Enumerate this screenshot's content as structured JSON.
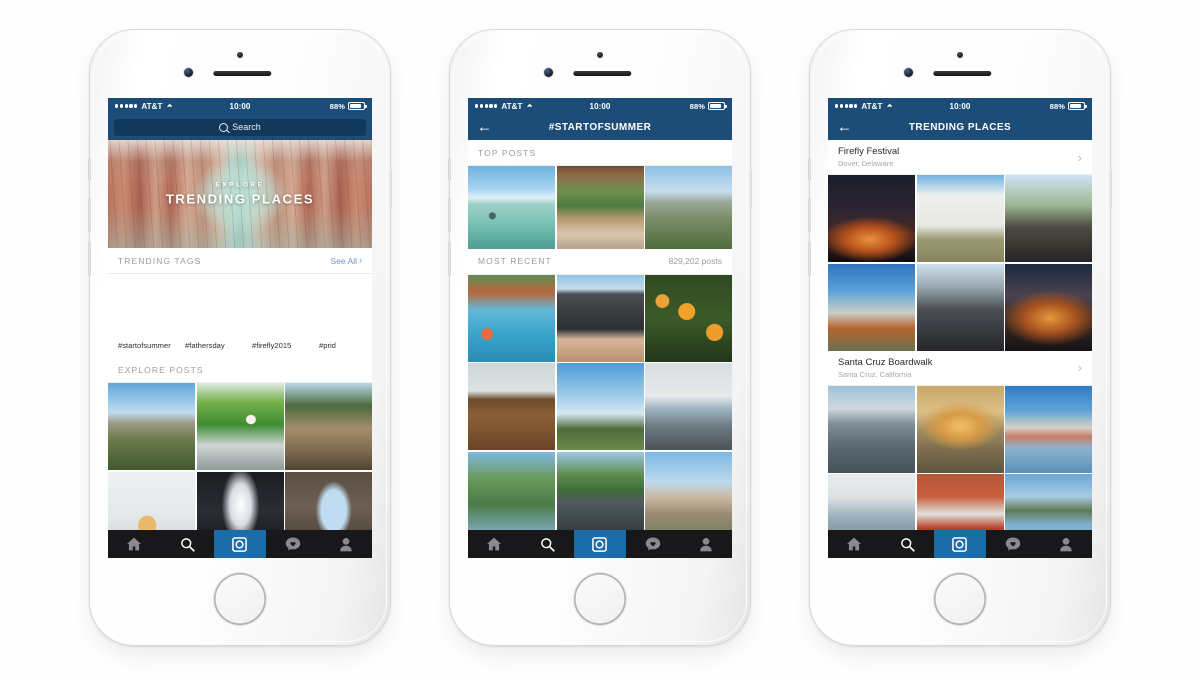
{
  "status_bar": {
    "carrier": "AT&T",
    "time": "10:00",
    "battery_percent": "88%",
    "signal_dots": 5
  },
  "phone1": {
    "search": {
      "placeholder": "Search",
      "value": "Search"
    },
    "hero": {
      "eyebrow": "EXPLORE",
      "title": "TRENDING PLACES"
    },
    "trending_tags": {
      "section_label": "TRENDING TAGS",
      "see_all": "See All",
      "items": [
        {
          "label": "#startofsummer",
          "art": "p-surf"
        },
        {
          "label": "#fathersday",
          "art": "p-dogman"
        },
        {
          "label": "#firefly2015",
          "art": "p-firefly"
        },
        {
          "label": "#prid",
          "art": "p-pride"
        }
      ]
    },
    "explore_posts": {
      "section_label": "EXPLORE POSTS",
      "tiles": [
        "p-city1",
        "p-yoga",
        "p-stairs",
        "p-hat",
        "p-tunnel",
        "p-arch"
      ]
    }
  },
  "phone2": {
    "nav_title": "#STARTOFSUMMER",
    "back_icon": "back-arrow-icon",
    "top_posts": {
      "section_label": "TOP POSTS",
      "tiles": [
        "p-surf",
        "p-hammock",
        "p-bayview"
      ]
    },
    "most_recent": {
      "section_label": "MOST RECENT",
      "count_label": "829,202 posts",
      "tiles": [
        "p-pool",
        "p-phone",
        "p-orange",
        "p-chairs",
        "p-sky",
        "p-truck",
        "p-trees",
        "p-road",
        "p-housing"
      ]
    }
  },
  "phone3": {
    "nav_title": "TRENDING PLACES",
    "back_icon": "back-arrow-icon",
    "places": [
      {
        "name": "Firefly Festival",
        "location": "Dover, Delaware",
        "tiles": [
          "p-silhouette",
          "p-records",
          "p-fest",
          "p-stilt",
          "p-stage",
          "p-dusk"
        ]
      },
      {
        "name": "Santa Cruz Boardwalk",
        "location": "Santa Cruz, California",
        "tiles": [
          "p-pier",
          "p-sunset",
          "p-coast",
          "p-fish",
          "p-shack",
          "p-lagoon"
        ]
      }
    ]
  },
  "tab_bar": {
    "items": [
      {
        "name": "home-icon",
        "active": false
      },
      {
        "name": "search-icon",
        "active": false
      },
      {
        "name": "camera-icon",
        "active": true
      },
      {
        "name": "activity-icon",
        "active": false
      },
      {
        "name": "profile-icon",
        "active": false
      }
    ]
  },
  "colors": {
    "header_blue": "#1b4d78",
    "search_field_blue": "#12395c",
    "tabbar_dark": "#18181a",
    "tab_active_blue": "#1b6ca8",
    "link_blue": "#6b9ac4",
    "muted_gray": "#9b9b9b"
  }
}
